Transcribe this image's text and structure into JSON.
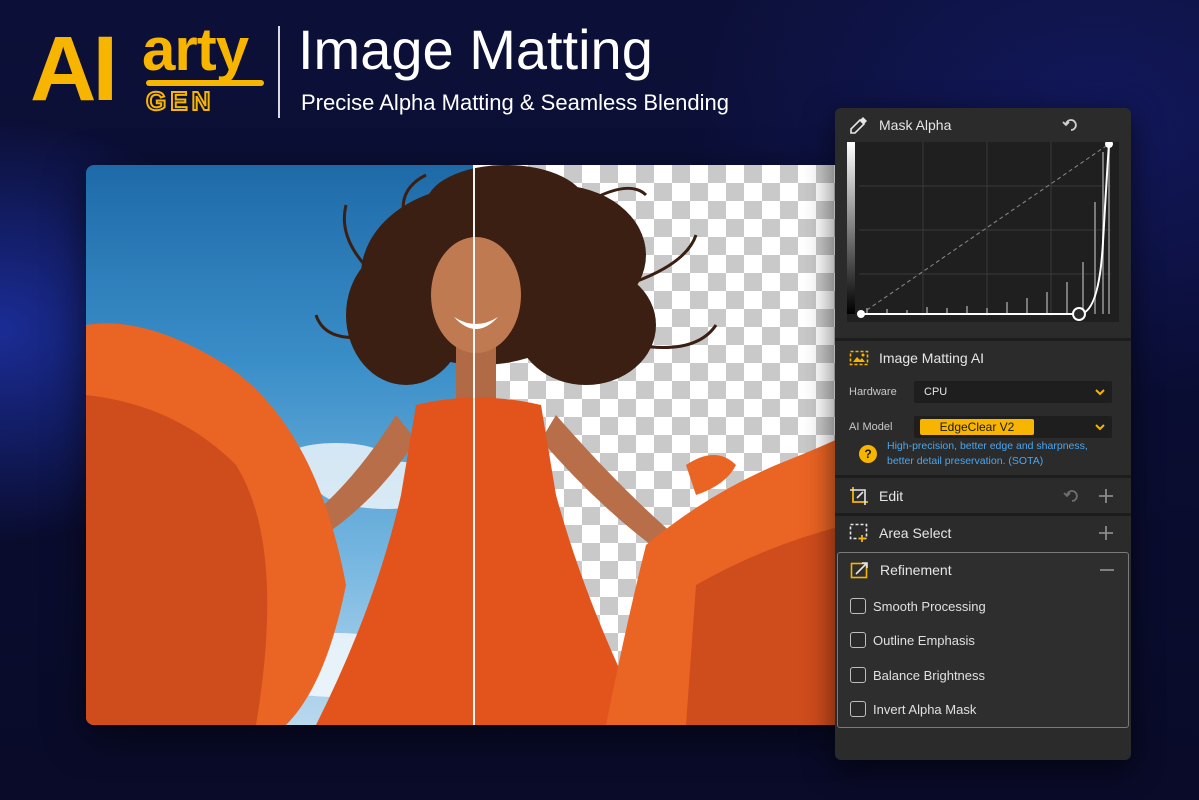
{
  "brand": {
    "logo_ai": "AI",
    "logo_arty": "arty",
    "logo_gen": "GEN",
    "accent_color": "#f7b500"
  },
  "header": {
    "title": "Image Matting",
    "subtitle": "Precise Alpha Matting & Seamless Blending"
  },
  "preview": {
    "left_view": "original-with-sky",
    "right_view": "transparent-checkerboard"
  },
  "panel": {
    "mask_alpha": {
      "label": "Mask Alpha",
      "icon": "eyedropper-icon",
      "reset_icon": "undo-icon"
    },
    "image_matting_ai": {
      "label": "Image Matting AI",
      "icon": "image-icon",
      "hardware_label": "Hardware",
      "hardware_value": "CPU",
      "model_label": "AI Model",
      "model_value": "EdgeClear  V2",
      "help_icon_text": "?",
      "help_text": "High-precision, better edge and sharpness, better detail preservation. (SOTA)"
    },
    "edit": {
      "label": "Edit",
      "icon": "crop-edit-icon"
    },
    "area_select": {
      "label": "Area Select",
      "icon": "marquee-select-icon"
    },
    "refinement": {
      "label": "Refinement",
      "icon": "refine-icon",
      "options": [
        {
          "label": "Smooth Processing",
          "checked": false
        },
        {
          "label": "Outline Emphasis",
          "checked": false
        },
        {
          "label": "Balance Brightness",
          "checked": false
        },
        {
          "label": "Invert Alpha Mask",
          "checked": false
        }
      ]
    }
  }
}
